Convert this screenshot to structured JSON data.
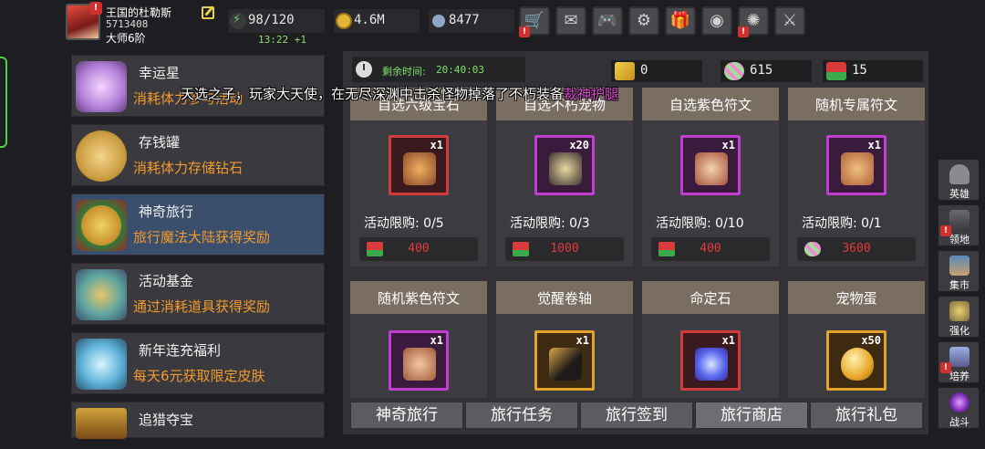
{
  "player": {
    "name": "王国的杜勒斯",
    "id": "5713408",
    "rank": "大师6阶"
  },
  "resources": {
    "energy": "98/120",
    "energy_timer": "13:22 +1",
    "coins": "4.6M",
    "gems": "8477"
  },
  "toolbar_icons": [
    "cart-icon",
    "mail-icon",
    "gamepad-icon",
    "gear-icon",
    "gift-icon",
    "color-wheel-icon",
    "fireworks-icon",
    "swords-icon"
  ],
  "menu": [
    {
      "title": "幸运星",
      "desc": "消耗体力参与活动",
      "icon": "lucky-star-icon"
    },
    {
      "title": "存钱罐",
      "desc": "消耗体力存储钻石",
      "icon": "piggy-bank-icon"
    },
    {
      "title": "神奇旅行",
      "desc": "旅行魔法大陆获得奖励",
      "icon": "travel-bell-icon"
    },
    {
      "title": "活动基金",
      "desc": "通过消耗道具获得奖励",
      "icon": "fund-bag-icon"
    },
    {
      "title": "新年连充福利",
      "desc": "每天6元获取限定皮肤",
      "icon": "crystal-icon"
    },
    {
      "title": "追猎夺宝",
      "desc": "",
      "icon": "treasure-chest-icon"
    }
  ],
  "shop": {
    "countdown_label": "剩余时间:",
    "countdown": "20:40:03",
    "currency": {
      "tickets": "0",
      "candy": "615",
      "socks": "15"
    },
    "announcement": {
      "text": "天选之子，玩家大天使，在无尽深渊中击杀怪物掉落了不朽装备",
      "highlight": "裁神护腿"
    },
    "cards": [
      {
        "title": "自选六级宝石",
        "qty": "x1",
        "limit": "活动限购:  0/5",
        "price": "400",
        "currency": "sock-icon",
        "frame": "red"
      },
      {
        "title": "自选不朽宠物",
        "qty": "x20",
        "limit": "活动限购:  0/3",
        "price": "1000",
        "currency": "sock-icon",
        "frame": "purple"
      },
      {
        "title": "自选紫色符文",
        "qty": "x1",
        "limit": "活动限购:  0/10",
        "price": "400",
        "currency": "sock-icon",
        "frame": "purple"
      },
      {
        "title": "随机专属符文",
        "qty": "x1",
        "limit": "活动限购:  0/1",
        "price": "3600",
        "currency": "candy-icon",
        "frame": "purple"
      },
      {
        "title": "随机紫色符文",
        "qty": "x1",
        "frame": "purple"
      },
      {
        "title": "觉醒卷轴",
        "qty": "x1",
        "frame": "gold"
      },
      {
        "title": "命定石",
        "qty": "x1",
        "frame": "red"
      },
      {
        "title": "宠物蛋",
        "qty": "x50",
        "frame": "gold"
      }
    ],
    "tabs": [
      "神奇旅行",
      "旅行任务",
      "旅行签到",
      "旅行商店",
      "旅行礼包"
    ]
  },
  "side_nav": [
    {
      "label": "英雄",
      "icon": "helmet-icon"
    },
    {
      "label": "领地",
      "icon": "castle-icon"
    },
    {
      "label": "集市",
      "icon": "market-icon"
    },
    {
      "label": "强化",
      "icon": "enhance-icon"
    },
    {
      "label": "培养",
      "icon": "trophy-icon"
    },
    {
      "label": "战斗",
      "icon": "portal-icon"
    }
  ],
  "colors": {
    "accent_orange": "#f39a2d",
    "active_menu": "#3b4e6b",
    "price_red": "#e23b3b",
    "timer_green": "#7ee26a"
  }
}
